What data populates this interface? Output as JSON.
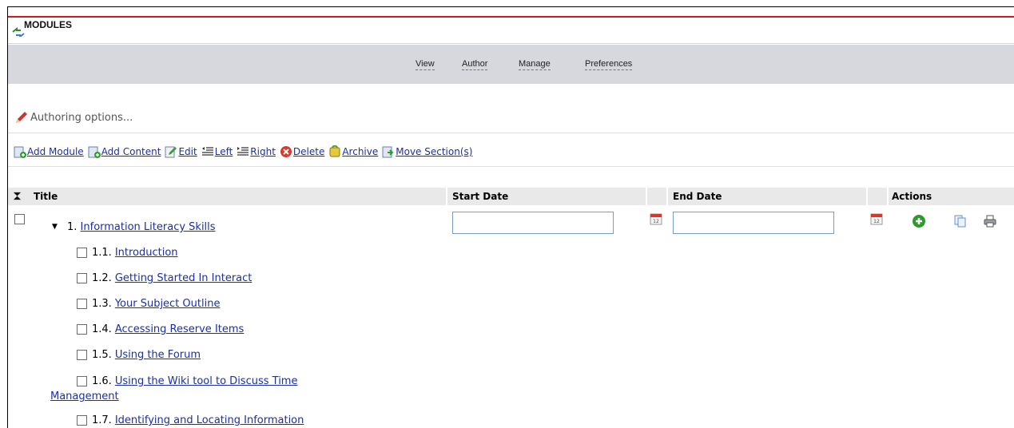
{
  "module_header": {
    "title": "MODULES",
    "icon": "refresh-arrows-icon"
  },
  "tabs": [
    {
      "label": "View"
    },
    {
      "label": "Author"
    },
    {
      "label": "Manage"
    },
    {
      "label": "Preferences"
    }
  ],
  "authoring": {
    "label": "Authoring options...",
    "icon": "pencil-icon"
  },
  "toolbar": [
    {
      "label": "Add Module",
      "icon": "add-module-icon"
    },
    {
      "label": "Add Content",
      "icon": "add-content-icon"
    },
    {
      "label": "Edit",
      "icon": "edit-icon"
    },
    {
      "label": "Left",
      "icon": "indent-left-icon"
    },
    {
      "label": "Right",
      "icon": "indent-right-icon"
    },
    {
      "label": "Delete",
      "icon": "delete-icon"
    },
    {
      "label": "Archive",
      "icon": "archive-icon"
    },
    {
      "label": "Move Section(s)",
      "icon": "move-section-icon"
    }
  ],
  "table": {
    "headers": {
      "select_all_icon": "hourglass-icon",
      "title": "Title",
      "start_date": "Start Date",
      "end_date": "End Date",
      "actions": "Actions"
    }
  },
  "module": {
    "number": "1.",
    "title": "Information Literacy Skills",
    "start_date": "",
    "end_date": "",
    "actions": [
      "add-icon",
      "copy-icon",
      "print-icon"
    ],
    "sections": [
      {
        "number": "1.1.",
        "title": "Introduction"
      },
      {
        "number": "1.2.",
        "title": "Getting Started In Interact"
      },
      {
        "number": "1.3.",
        "title": "Your Subject Outline"
      },
      {
        "number": "1.4.",
        "title": "Accessing Reserve Items"
      },
      {
        "number": "1.5.",
        "title": "Using the Forum"
      },
      {
        "number": "1.6.",
        "title": "Using the Wiki tool to Discuss Time",
        "title_cont": "Management"
      },
      {
        "number": "1.7.",
        "title": "Identifying and Locating Information"
      }
    ]
  },
  "colors": {
    "link": "#1a2fa8",
    "accent_red": "#cc1a1a",
    "tabbar_bg": "#d6d8de",
    "header_bg": "#e9e9e9"
  }
}
